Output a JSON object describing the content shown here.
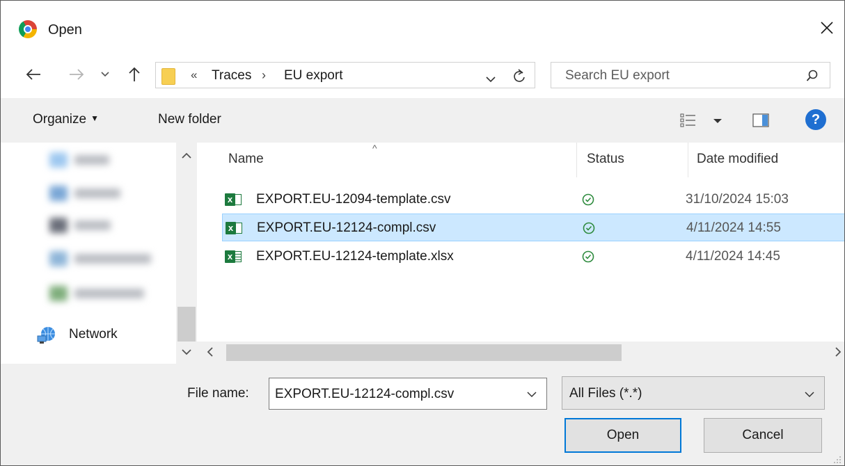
{
  "window": {
    "title": "Open",
    "app_icon": "chrome-icon"
  },
  "nav": {
    "breadcrumb_overflow": "«",
    "breadcrumb": [
      "Traces",
      "EU export"
    ],
    "breadcrumb_separator": "›",
    "search_placeholder": "Search EU export"
  },
  "commands": {
    "organize": "Organize",
    "new_folder": "New folder"
  },
  "sidebar": {
    "network_label": "Network"
  },
  "file_list": {
    "columns": [
      "Name",
      "Status",
      "Date modified"
    ],
    "sort_indicator": "^",
    "files": [
      {
        "name": "EXPORT.EU-12094-template.csv",
        "status": "synced",
        "date": "31/10/2024 15:03",
        "selected": false
      },
      {
        "name": "EXPORT.EU-12124-compl.csv",
        "status": "synced",
        "date": "4/11/2024 14:55",
        "selected": true
      },
      {
        "name": "EXPORT.EU-12124-template.xlsx",
        "status": "synced",
        "date": "4/11/2024 14:45",
        "selected": false
      }
    ]
  },
  "bottom": {
    "file_name_label": "File name:",
    "file_name_value": "EXPORT.EU-12124-compl.csv",
    "filter_value": "All Files (*.*)",
    "open_button": "Open",
    "cancel_button": "Cancel"
  },
  "colors": {
    "selection_bg": "#cce8ff",
    "selection_border": "#99d1ff",
    "status_ok": "#2e8b3e",
    "excel_green": "#1d7a3e",
    "help_blue": "#1f6fd1",
    "default_button_border": "#0078d7"
  }
}
